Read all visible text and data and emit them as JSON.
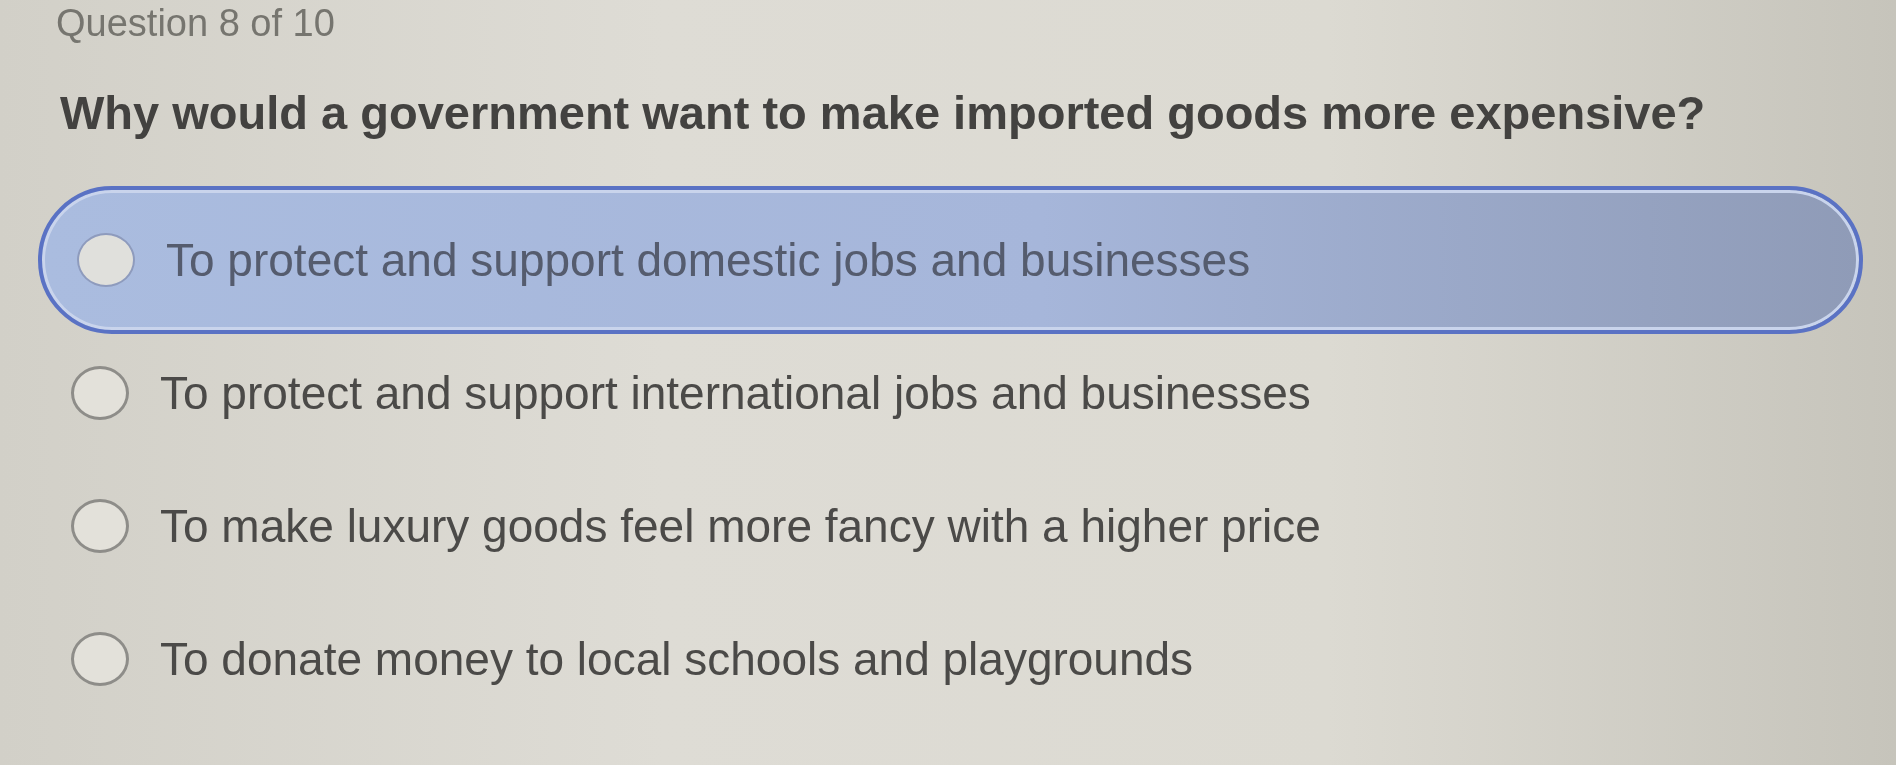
{
  "header": {
    "progress": "Question 8 of 10"
  },
  "question": {
    "text": "Why would a government want to make imported goods more expensive?"
  },
  "options": [
    {
      "label": "To protect and support domestic jobs and businesses",
      "selected": true
    },
    {
      "label": "To protect and support international jobs and businesses",
      "selected": false
    },
    {
      "label": "To make luxury goods feel more fancy with a higher price",
      "selected": false
    },
    {
      "label": "To donate money to local schools and playgrounds",
      "selected": false
    }
  ]
}
